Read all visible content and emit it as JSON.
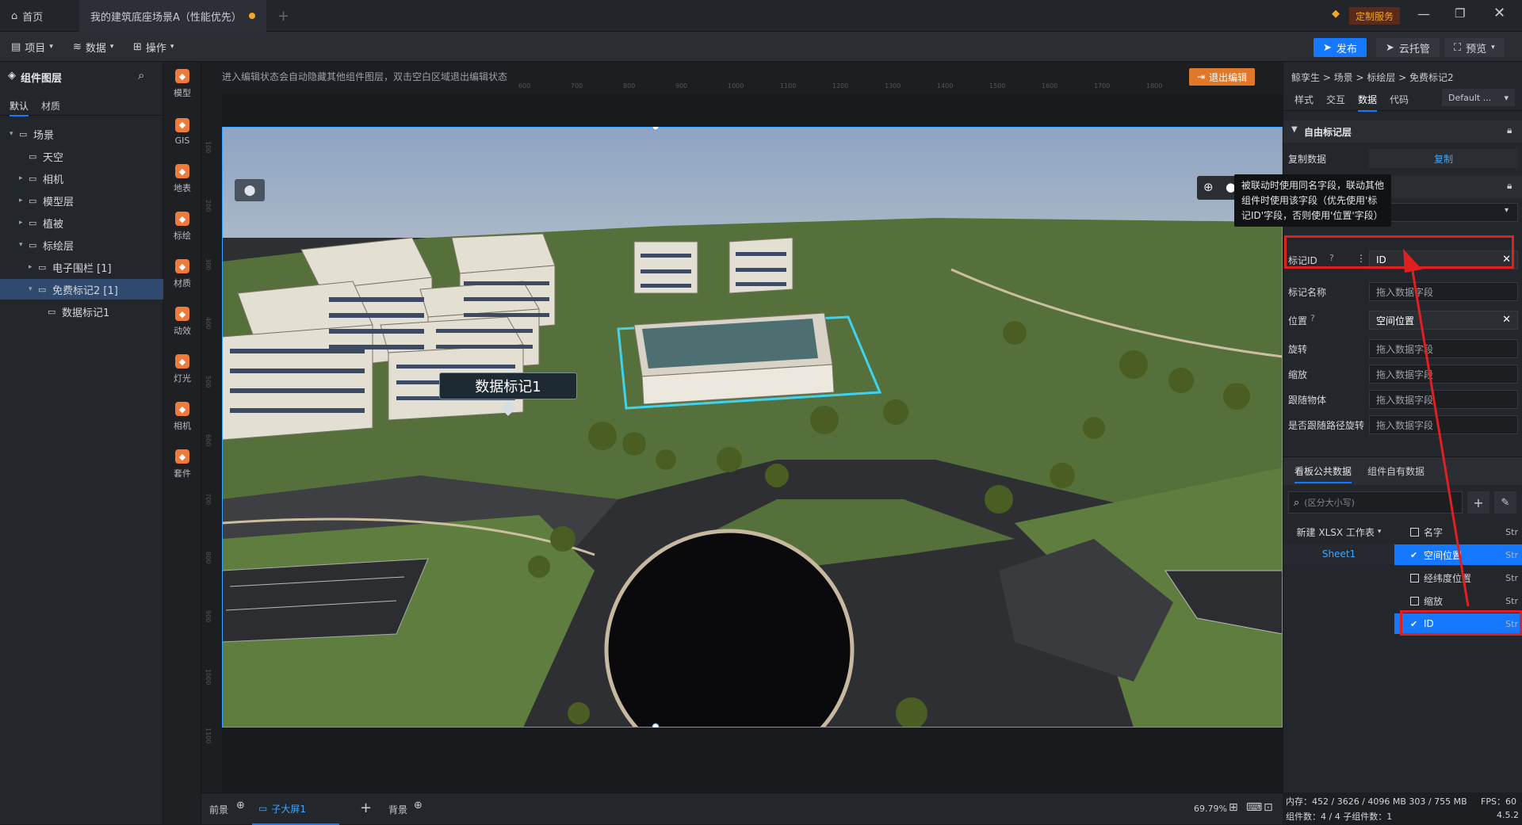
{
  "titlebar": {
    "home_label": "首页",
    "doc_tab": "我的建筑底座场景A（性能优先）",
    "custom_service": "定制服务"
  },
  "toolbar": {
    "project": "项目",
    "data": "数据",
    "ops": "操作",
    "publish": "发布",
    "cloud": "云托管",
    "preview": "预览"
  },
  "leftpanel": {
    "title": "组件图层",
    "tabs": [
      "默认",
      "材质"
    ],
    "tree": [
      {
        "label": "场景",
        "indent": 0,
        "caret": "▾",
        "icon": "scene-icon"
      },
      {
        "label": "天空",
        "indent": 1,
        "caret": "",
        "icon": "sky-icon"
      },
      {
        "label": "相机",
        "indent": 1,
        "caret": "▸",
        "icon": "folder-icon"
      },
      {
        "label": "模型层",
        "indent": 1,
        "caret": "▸",
        "icon": "folder-icon"
      },
      {
        "label": "植被",
        "indent": 1,
        "caret": "▸",
        "icon": "folder-icon"
      },
      {
        "label": "标绘层",
        "indent": 1,
        "caret": "▾",
        "icon": "folder-icon"
      },
      {
        "label": "电子围栏 [1]",
        "indent": 2,
        "caret": "▸",
        "icon": "fence-icon"
      },
      {
        "label": "免费标记2 [1]",
        "indent": 2,
        "caret": "▾",
        "icon": "marker-icon",
        "selected": true
      },
      {
        "label": "数据标记1",
        "indent": 3,
        "caret": "",
        "icon": "data-marker-icon"
      }
    ]
  },
  "iconbar": [
    {
      "label": "模型"
    },
    {
      "label": "GIS"
    },
    {
      "label": "地表"
    },
    {
      "label": "标绘"
    },
    {
      "label": "材质"
    },
    {
      "label": "动效"
    },
    {
      "label": "灯光"
    },
    {
      "label": "相机"
    },
    {
      "label": "套件"
    }
  ],
  "stage": {
    "hint": "进入编辑状态会自动隐藏其他组件图层，双击空白区域退出编辑状态",
    "exit_edit": "退出编辑",
    "marker_label": "数据标记1",
    "ruler_top": [
      "600",
      "700",
      "800",
      "900",
      "1000",
      "1100",
      "1200",
      "1300",
      "1400",
      "1500",
      "1600",
      "1700",
      "1800"
    ],
    "ruler_left": [
      "100",
      "200",
      "300",
      "400",
      "500",
      "600",
      "700",
      "800",
      "900",
      "1000",
      "1100"
    ]
  },
  "tooltip": "被联动时使用同名字段，联动其他组件时使用该字段（优先使用'标记ID'字段，否则使用'位置'字段）",
  "rightpanel": {
    "breadcrumb": "鲸孪生 > 场景 > 标绘层 > 免费标记2",
    "tabs": [
      "样式",
      "交互",
      "数据",
      "代码"
    ],
    "active_tab": "数据",
    "default_select": "Default ...",
    "section_title": "自由标记层",
    "copy_data_label": "复制数据",
    "copy_btn": "复制",
    "fields": [
      {
        "label": "标记ID",
        "value": "ID",
        "help": true,
        "filled": true
      },
      {
        "label": "标记名称",
        "value": "拖入数据字段"
      },
      {
        "label": "位置",
        "value": "空间位置",
        "help": true,
        "filled": true
      },
      {
        "label": "旋转",
        "value": "拖入数据字段"
      },
      {
        "label": "缩放",
        "value": "拖入数据字段"
      },
      {
        "label": "跟随物体",
        "value": "拖入数据字段"
      },
      {
        "label": "是否跟随路径旋转",
        "value": "拖入数据字段"
      }
    ],
    "data_tabs": [
      "看板公共数据",
      "组件自有数据"
    ],
    "search_placeholder": "(区分大小写)",
    "workbook": "新建 XLSX 工作表",
    "sheet": "Sheet1",
    "columns": [
      {
        "name": "名字",
        "checked": false,
        "type": "Str"
      },
      {
        "name": "空间位置",
        "checked": true,
        "type": "Str"
      },
      {
        "name": "经纬度位置",
        "checked": false,
        "type": "Str"
      },
      {
        "name": "缩放",
        "checked": false,
        "type": "Str"
      },
      {
        "name": "ID",
        "checked": true,
        "type": "Str"
      }
    ]
  },
  "bottombar": {
    "front": "前景",
    "sub": "子大屏1",
    "back": "背景",
    "zoom": "69.79%"
  },
  "status": {
    "memory": "内存：452 / 3626 / 4096 MB  303 / 755 MB",
    "fps": "FPS：60",
    "components": "组件数：4 / 4   子组件数：1",
    "version": "4.5.2"
  },
  "colors": {
    "accent": "#1677ff",
    "highlight": "#e02020",
    "orange": "#f07a3a"
  }
}
